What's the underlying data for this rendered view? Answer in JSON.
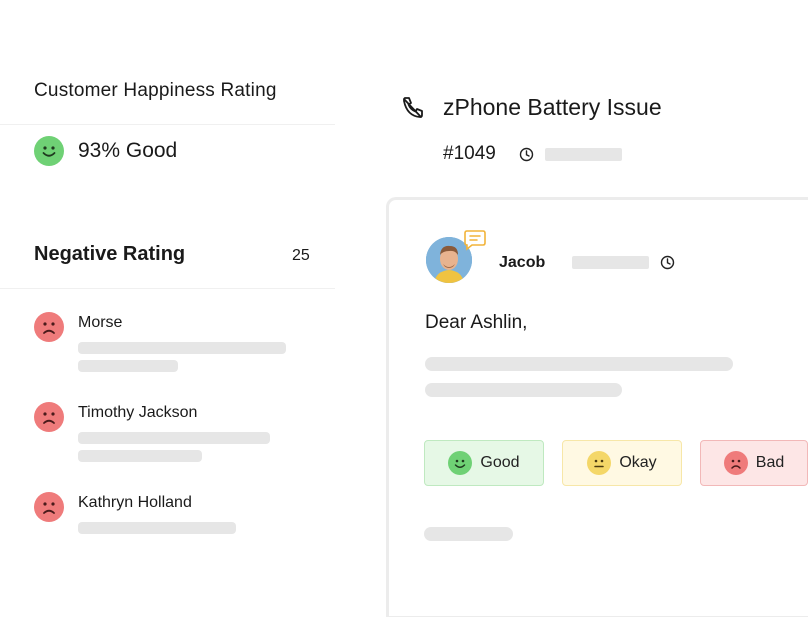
{
  "happiness": {
    "title": "Customer Happiness Rating",
    "score_label": "93% Good",
    "icon": "smile-face-icon",
    "color": "#6fd175"
  },
  "negative": {
    "title": "Negative Rating",
    "count": "25",
    "icon_color": "#ef7b7b",
    "items": [
      {
        "name": "Morse"
      },
      {
        "name": "Timothy Jackson"
      },
      {
        "name": "Kathryn Holland"
      }
    ]
  },
  "ticket": {
    "title": "zPhone Battery Issue",
    "id": "#1049",
    "icon": "phone-call-icon"
  },
  "message": {
    "sender": "Jacob",
    "greeting": "Dear Ashlin,"
  },
  "ratings": [
    {
      "label": "Good",
      "bg": "#e6f8e6",
      "border": "#bfe9c0",
      "face": "#6fd175"
    },
    {
      "label": "Okay",
      "bg": "#fff9e3",
      "border": "#f7e7a8",
      "face": "#f4d768"
    },
    {
      "label": "Bad",
      "bg": "#fde6e6",
      "border": "#f2b8b8",
      "face": "#ef7b7b"
    }
  ]
}
